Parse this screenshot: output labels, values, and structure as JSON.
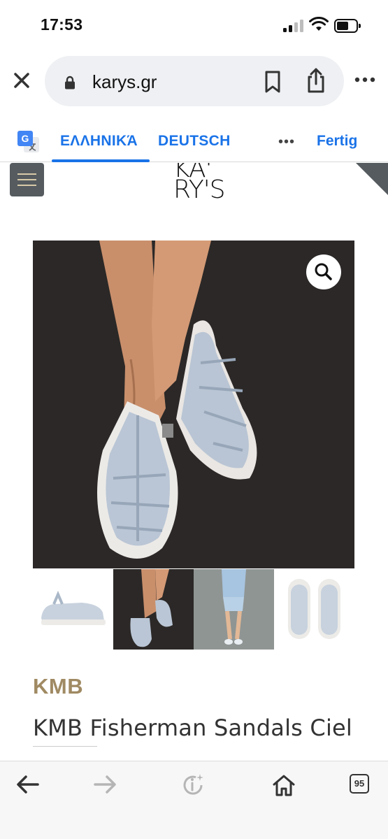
{
  "status": {
    "time": "17:53"
  },
  "browser": {
    "url": "karys.gr",
    "close_icon": "close-icon",
    "lock_icon": "lock-icon",
    "bookmark_icon": "bookmark-icon",
    "share_icon": "share-icon",
    "more_icon": "more-icon"
  },
  "translate": {
    "languages": [
      "ΕΛΛΗΝΙΚΆ",
      "DEUTSCH"
    ],
    "active_index": 0,
    "more": "•••",
    "done": "Fertig"
  },
  "site": {
    "logo_line1": "KA'",
    "logo_line2": "RY'S"
  },
  "product": {
    "brand": "KMB",
    "title": "KMB Fisherman Sandals Ciel",
    "thumbnail_count": 4
  },
  "toolbar": {
    "tabs_count": "95"
  },
  "colors": {
    "accent_blue": "#1a73e8",
    "brand_gold": "#a08a63",
    "header_gray": "#555b5f"
  }
}
